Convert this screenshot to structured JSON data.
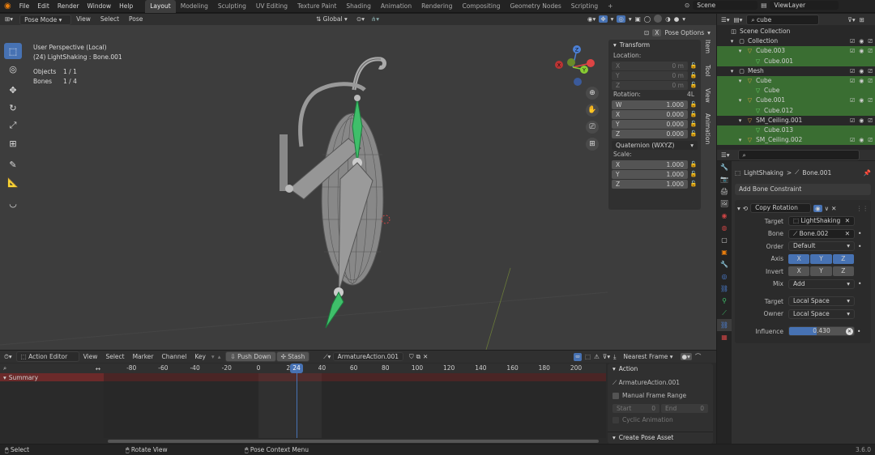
{
  "topbar": {
    "menus": [
      "File",
      "Edit",
      "Render",
      "Window",
      "Help"
    ],
    "workspaces": [
      "Layout",
      "Modeling",
      "Sculpting",
      "UV Editing",
      "Texture Paint",
      "Shading",
      "Animation",
      "Rendering",
      "Compositing",
      "Geometry Nodes",
      "Scripting"
    ],
    "active_workspace": "Layout",
    "add_tab": "+",
    "scene": "Scene",
    "view_layer": "ViewLayer"
  },
  "viewport": {
    "mode": "Pose Mode",
    "menus": [
      "View",
      "Select",
      "Pose"
    ],
    "orientation": "Global",
    "pose_options": "Pose Options",
    "info_title": "User Perspective (Local)",
    "info_sub": "(24) LightShaking : Bone.001",
    "objects_label": "Objects",
    "objects_val": "1 / 1",
    "bones_label": "Bones",
    "bones_val": "1 / 4",
    "gizmo": {
      "z": "Z",
      "y": "Y",
      "x": "X"
    }
  },
  "npanel": {
    "section": "Transform",
    "location_label": "Location:",
    "location": [
      {
        "axis": "X",
        "val": "0 m"
      },
      {
        "axis": "Y",
        "val": "0 m"
      },
      {
        "axis": "Z",
        "val": "0 m"
      }
    ],
    "rotation_label": "Rotation:",
    "rotation_mode_short": "4L",
    "rotation": [
      {
        "axis": "W",
        "val": "1.000"
      },
      {
        "axis": "X",
        "val": "0.000"
      },
      {
        "axis": "Y",
        "val": "0.000"
      },
      {
        "axis": "Z",
        "val": "0.000"
      }
    ],
    "rotation_mode": "Quaternion (WXYZ)",
    "scale_label": "Scale:",
    "scale": [
      {
        "axis": "X",
        "val": "1.000"
      },
      {
        "axis": "Y",
        "val": "1.000"
      },
      {
        "axis": "Z",
        "val": "1.000"
      }
    ],
    "tabs": [
      "Item",
      "Tool",
      "View",
      "Animation"
    ]
  },
  "outliner": {
    "search": "cube",
    "rows": [
      {
        "label": "Scene Collection",
        "indent": 0,
        "sel": false,
        "icon": "scene",
        "color": "#ddd"
      },
      {
        "label": "Collection",
        "indent": 1,
        "sel": false,
        "icon": "collection",
        "color": "#ddd"
      },
      {
        "label": "Cube.003",
        "indent": 2,
        "sel": true,
        "icon": "object",
        "color": "#e0a040"
      },
      {
        "label": "Cube.001",
        "indent": 3,
        "sel": true,
        "icon": "mesh",
        "color": "#6bd96b"
      },
      {
        "label": "Mesh",
        "indent": 1,
        "sel": false,
        "icon": "collection",
        "color": "#ddd"
      },
      {
        "label": "Cube",
        "indent": 2,
        "sel": true,
        "icon": "object",
        "color": "#e0a040"
      },
      {
        "label": "Cube",
        "indent": 3,
        "sel": true,
        "icon": "mesh",
        "color": "#6bd96b"
      },
      {
        "label": "Cube.001",
        "indent": 2,
        "sel": true,
        "icon": "object",
        "color": "#e0a040"
      },
      {
        "label": "Cube.012",
        "indent": 3,
        "sel": true,
        "icon": "mesh",
        "color": "#6bd96b"
      },
      {
        "label": "SM_Ceiling.001",
        "indent": 2,
        "sel": false,
        "icon": "object",
        "color": "#e0a040"
      },
      {
        "label": "Cube.013",
        "indent": 3,
        "sel": true,
        "icon": "mesh",
        "color": "#6bd96b"
      },
      {
        "label": "SM_Ceiling.002",
        "indent": 2,
        "sel": true,
        "icon": "object",
        "color": "#e0a040"
      }
    ]
  },
  "props": {
    "breadcrumb_obj": "LightShaking",
    "breadcrumb_sep": ">",
    "breadcrumb_bone": "Bone.001",
    "add_constraint": "Add Bone Constraint",
    "constraint_name": "Copy Rotation",
    "target_label": "Target",
    "target_val": "LightShaking",
    "bone_label": "Bone",
    "bone_val": "Bone.002",
    "order_label": "Order",
    "order_val": "Default",
    "axis_label": "Axis",
    "invert_label": "Invert",
    "xyz": [
      "X",
      "Y",
      "Z"
    ],
    "mix_label": "Mix",
    "mix_val": "Add",
    "target_space_label": "Target",
    "target_space": "Local Space",
    "owner_space_label": "Owner",
    "owner_space": "Local Space",
    "influence_label": "Influence",
    "influence_val": "0.430",
    "influence_fraction": 0.43
  },
  "action_editor": {
    "mode": "Action Editor",
    "menus": [
      "View",
      "Select",
      "Marker",
      "Channel",
      "Key"
    ],
    "push_down": "Push Down",
    "stash": "Stash",
    "action_name": "ArmatureAction.001",
    "snapping": "Nearest Frame",
    "summary": "Summary",
    "current_frame": "24",
    "ticks": [
      "-80",
      "-60",
      "-40",
      "-20",
      "0",
      "20",
      "40",
      "60",
      "80",
      "100",
      "120",
      "140",
      "160",
      "180",
      "200"
    ],
    "panel_title": "Action",
    "panel_action": "ArmatureAction.001",
    "manual_range": "Manual Frame Range",
    "start_label": "Start",
    "start_val": "0",
    "end_label": "End",
    "end_val": "0",
    "cyclic": "Cyclic Animation",
    "create_pose": "Create Pose Asset"
  },
  "status": {
    "select": "Select",
    "rotate": "Rotate View",
    "context": "Pose Context Menu",
    "version": "3.6.0"
  }
}
